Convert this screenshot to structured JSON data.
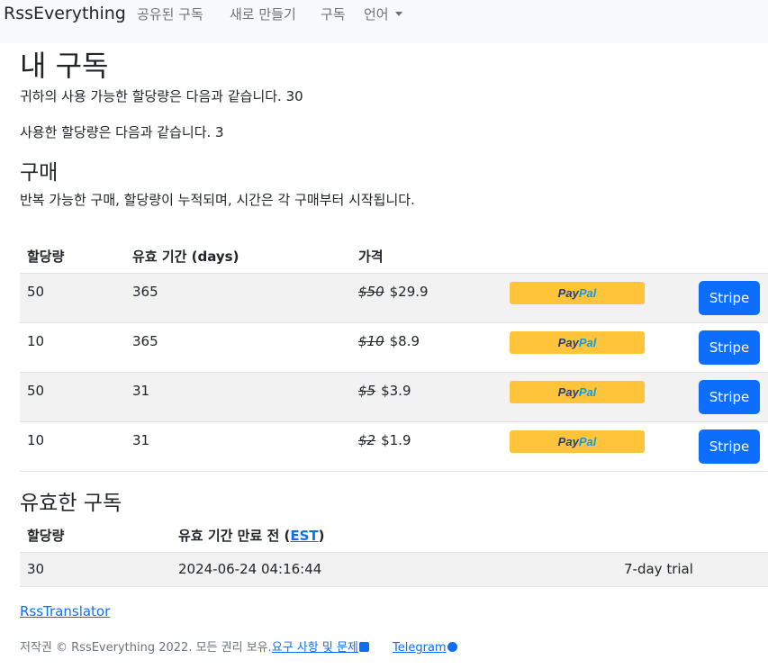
{
  "navbar": {
    "brand": "RssEverything",
    "links": [
      "공유된 구독",
      "새로 만들기",
      "구독"
    ],
    "language": "언어"
  },
  "page_title": "내 구독",
  "available_quota": "귀하의 사용 가능한 할당량은 다음과 같습니다. 30",
  "used_quota": "사용한 할당량은 다음과 같습니다. 3",
  "purchase": {
    "heading": "구매",
    "description": "반복 가능한 구매, 할당량이 누적되며, 시간은 각 구매부터 시작됩니다.",
    "columns": [
      "할당량",
      "유효 기간 (days)",
      "가격"
    ],
    "rows": [
      {
        "quota": "50",
        "days": "365",
        "old_price": "$50",
        "price": "$29.9"
      },
      {
        "quota": "10",
        "days": "365",
        "old_price": "$10",
        "price": "$8.9"
      },
      {
        "quota": "50",
        "days": "31",
        "old_price": "$5",
        "price": "$3.9"
      },
      {
        "quota": "10",
        "days": "31",
        "old_price": "$2",
        "price": "$1.9"
      }
    ],
    "paypal_label_1": "Pay",
    "paypal_label_2": "Pal",
    "stripe_label": "Stripe"
  },
  "active": {
    "heading": "유효한 구독",
    "col_quota": "할당량",
    "col_expiry_prefix": "유효 기간 만료 전 (",
    "col_expiry_link": "EST",
    "col_expiry_suffix": ")",
    "row": {
      "quota": "30",
      "expiry": "2024-06-24 04:16:44",
      "note": "7-day trial"
    }
  },
  "footer": {
    "link_translator": "RssTranslator",
    "copyright": "저작권 © RssEverything 2022. 모든 권리 보유.",
    "issues": "요구 사항 및 문제",
    "telegram": "Telegram"
  },
  "colors": {
    "primary": "#0d6efd",
    "paypal_yellow": "#ffc439",
    "navbar_bg": "#f8f9fa"
  }
}
